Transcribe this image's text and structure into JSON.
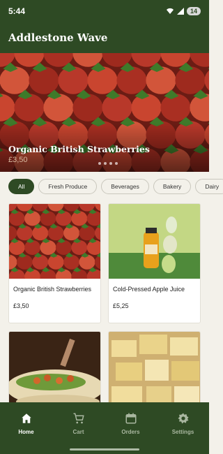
{
  "status": {
    "time": "5:44",
    "battery": "14"
  },
  "app": {
    "title": "Addlestone Wave"
  },
  "hero": {
    "title": "Organic British Strawberries",
    "price": "£3,50"
  },
  "chips": [
    {
      "label": "All",
      "active": true
    },
    {
      "label": "Fresh Produce",
      "active": false
    },
    {
      "label": "Beverages",
      "active": false
    },
    {
      "label": "Bakery",
      "active": false
    },
    {
      "label": "Dairy",
      "active": false
    }
  ],
  "products": [
    {
      "name": "Organic British Strawberries",
      "price": "£3,50",
      "icon": "strawberries-image"
    },
    {
      "name": "Cold-Pressed Apple Juice",
      "price": "£5,25",
      "icon": "apple-juice-image"
    },
    {
      "name": "",
      "price": "",
      "icon": "tacos-image"
    },
    {
      "name": "",
      "price": "",
      "icon": "cheese-image"
    }
  ],
  "nav": [
    {
      "label": "Home",
      "icon": "home-icon",
      "active": true
    },
    {
      "label": "Cart",
      "icon": "cart-icon",
      "active": false
    },
    {
      "label": "Orders",
      "icon": "calendar-icon",
      "active": false
    },
    {
      "label": "Settings",
      "icon": "gear-icon",
      "active": false
    }
  ],
  "colors": {
    "primary": "#2e4a24",
    "background": "#f3f1ea"
  }
}
